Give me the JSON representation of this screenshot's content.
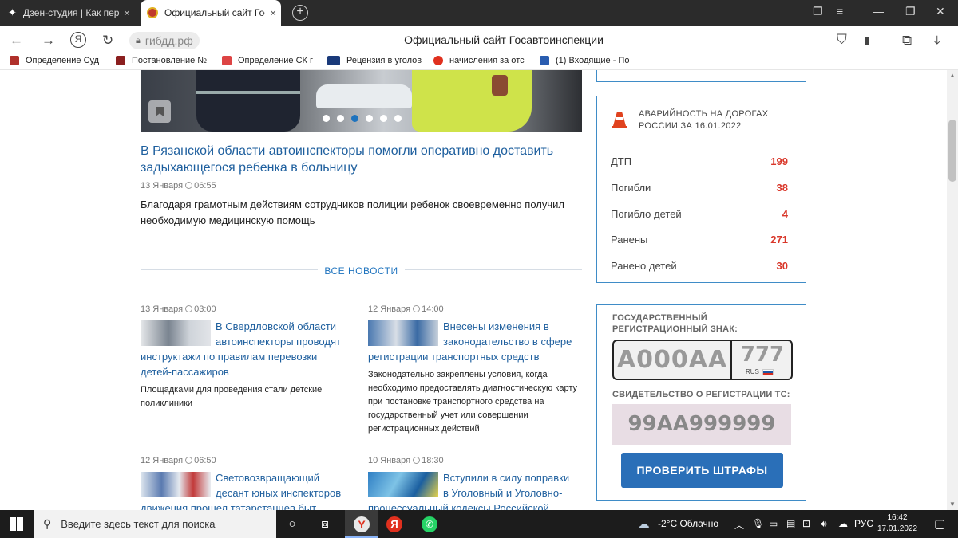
{
  "browser": {
    "tabs": [
      {
        "title": "Дзен-студия | Как переста"
      },
      {
        "title": "Официальный сайт Гос"
      }
    ],
    "url": "гибдд.рф",
    "page_title": "Официальный сайт Госавтоинспекции",
    "bookmarks": [
      {
        "label": "Определение Суд",
        "color": "#b0302b"
      },
      {
        "label": "Постановление №",
        "color": "#8b1f1f"
      },
      {
        "label": "Определение СК г",
        "color": "#d44"
      },
      {
        "label": "Рецензия в уголов",
        "color": "#1a3a7a"
      },
      {
        "label": "начисления за отс",
        "color": "#e0301e"
      },
      {
        "label": "(1) Входящие - По",
        "color": "#2a5db0"
      }
    ]
  },
  "lead": {
    "title": "В Рязанской области автоинспекторы помогли оперативно доставить задыхающегося ребенка в больницу",
    "date": "13 Января",
    "time": "06:55",
    "text": "Благодаря грамотным действиям сотрудников полиции ребенок своевременно получил необходимую медицинскую помощь"
  },
  "all_news_label": "ВСЕ НОВОСТИ",
  "news": [
    {
      "date": "13 Января",
      "time": "03:00",
      "title": "В Свердловской области автоинспекторы проводят инструктажи по правилам перевозки детей-пассажиров",
      "desc": "Площадками для проведения стали детские поликлиники"
    },
    {
      "date": "12 Января",
      "time": "14:00",
      "title": "Внесены изменения в законодательство в сфере регистрации транспортных средств",
      "desc": "Законодательно закреплены условия, когда необходимо предоставлять диагностическую карту при постановке транспортного средства на государственный учет или совершении регистрационных действий"
    },
    {
      "date": "12 Января",
      "time": "06:50",
      "title": "Световозвращающий десант юных инспекторов движения прошел татарстанцев быт",
      "desc": ""
    },
    {
      "date": "10 Января",
      "time": "18:30",
      "title": "Вступили в силу поправки в Уголовный и Уголовно-процессуальный кодексы Российской",
      "desc": ""
    }
  ],
  "accidents": {
    "title": "АВАРИЙНОСТЬ НА ДОРОГАХ РОССИИ ЗА 16.01.2022",
    "rows": [
      {
        "label": "ДТП",
        "value": "199"
      },
      {
        "label": "Погибли",
        "value": "38"
      },
      {
        "label": "Погибло детей",
        "value": "4"
      },
      {
        "label": "Ранены",
        "value": "271"
      },
      {
        "label": "Ранено детей",
        "value": "30"
      }
    ]
  },
  "fines": {
    "plate_label": "ГОСУДАРСТВЕННЫЙ РЕГИСТРАЦИОННЫЙ ЗНАК:",
    "plate_number": "А000АА",
    "plate_region": "777",
    "plate_country": "RUS",
    "cert_label": "СВИДЕТЕЛЬСТВО О РЕГИСТРАЦИИ ТС:",
    "cert_placeholder": "99АА999999",
    "button": "ПРОВЕРИТЬ ШТРАФЫ"
  },
  "taskbar": {
    "search_placeholder": "Введите здесь текст для поиска",
    "weather": "-2°C  Облачно",
    "lang": "РУС",
    "time": "16:42",
    "date": "17.01.2022"
  },
  "colors": {
    "link": "#1e5f9e",
    "accent": "#3f8cc7",
    "alert": "#d9372a",
    "button": "#2a6fb8"
  }
}
